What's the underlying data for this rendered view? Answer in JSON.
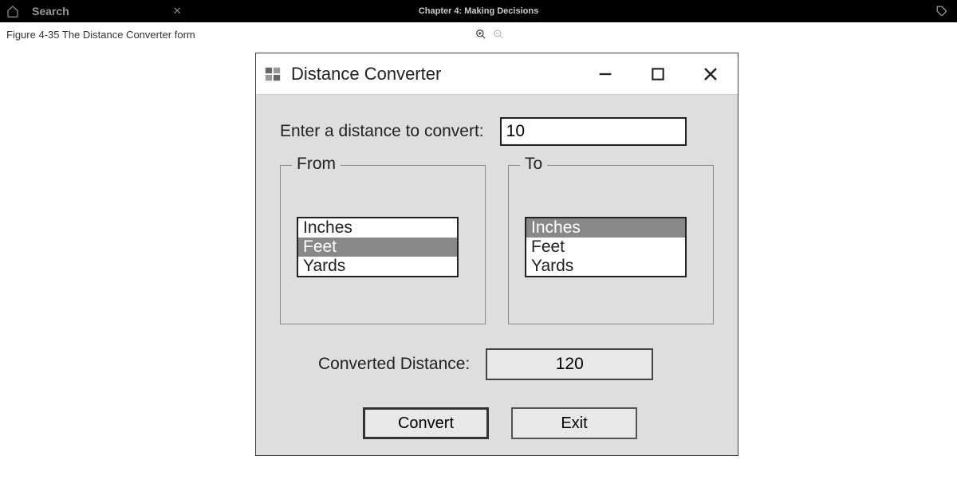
{
  "topbar": {
    "search": "Search",
    "chapter": "Chapter 4: Making Decisions"
  },
  "caption": "Figure 4-35 The Distance Converter form",
  "window": {
    "title": "Distance Converter"
  },
  "form": {
    "input_label": "Enter a distance to convert:",
    "input_value": "10",
    "from_legend": "From",
    "to_legend": "To",
    "units": {
      "0": "Inches",
      "1": "Feet",
      "2": "Yards"
    },
    "result_label": "Converted Distance:",
    "result_value": "120",
    "convert_btn": "Convert",
    "exit_btn": "Exit"
  }
}
